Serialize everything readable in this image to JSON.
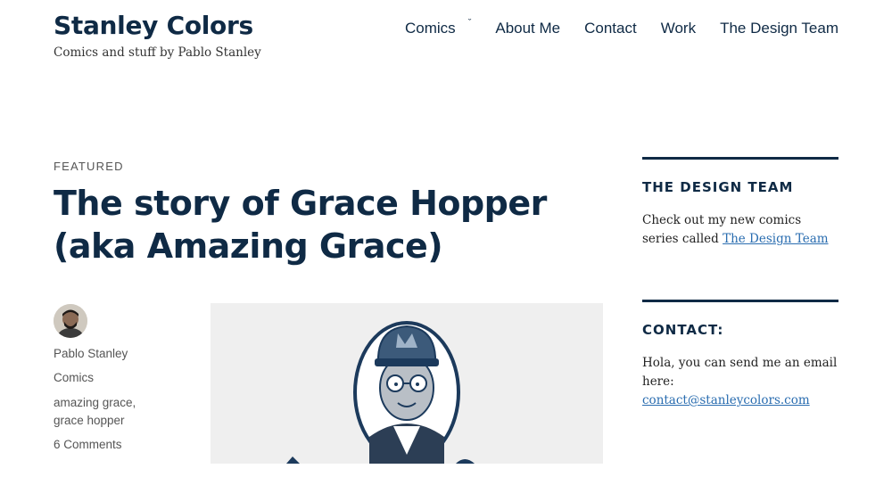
{
  "site": {
    "title": "Stanley Colors",
    "tagline": "Comics and stuff by Pablo Stanley"
  },
  "nav": {
    "items": [
      {
        "label": "Comics"
      },
      {
        "label": "About Me"
      },
      {
        "label": "Contact"
      },
      {
        "label": "Work"
      },
      {
        "label": "The Design Team"
      }
    ]
  },
  "post": {
    "kicker": "FEATURED",
    "title_line1": "The story of Grace Hopper",
    "title_line2": "(aka Amazing Grace)",
    "author": "Pablo Stanley",
    "category": "Comics",
    "tag1": "amazing grace,",
    "tag2": "grace hopper",
    "comments": "6 Comments"
  },
  "sidebar": {
    "design_team": {
      "title": "THE DESIGN TEAM",
      "text": "Check out my new comics series called",
      "link": "The Design Team"
    },
    "contact": {
      "title": "CONTACT:",
      "text": "Hola, you can send me an email here:",
      "link": "contact@stanleycolors.com"
    }
  },
  "colors": {
    "primary": "#0f2a45",
    "link": "#2a6db0",
    "muted": "#555555"
  }
}
